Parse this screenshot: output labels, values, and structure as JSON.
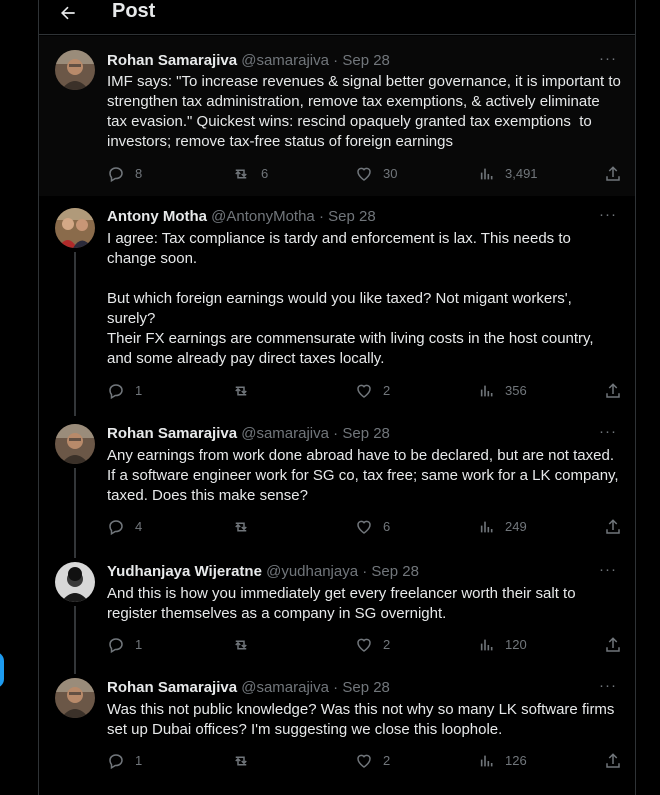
{
  "header": {
    "title": "Post"
  },
  "tweets": [
    {
      "name": "Rohan Samarajiva",
      "handle": "@samarajiva",
      "date": "Sep 28",
      "text": "IMF says: \"To increase revenues & signal better governance, it is important to strengthen tax administration, remove tax exemptions, & actively eliminate tax evasion.\" Quickest wins: rescind opaquely granted tax exemptions  to investors; remove tax-free status of foreign earnings",
      "replies": "8",
      "reposts": "6",
      "likes": "30",
      "views": "3,491"
    },
    {
      "name": "Antony Motha",
      "handle": "@AntonyMotha",
      "date": "Sep 28",
      "text": "I agree: Tax compliance is tardy and enforcement is lax. This needs to change soon.\n\nBut which foreign earnings would you like taxed? Not migant workers', surely?\nTheir FX earnings are commensurate with living costs in the host country, and some already pay direct taxes locally.",
      "replies": "1",
      "reposts": "",
      "likes": "2",
      "views": "356"
    },
    {
      "name": "Rohan Samarajiva",
      "handle": "@samarajiva",
      "date": "Sep 28",
      "text": "Any earnings from work done abroad have to be declared, but are not taxed. If a software engineer work for SG co, tax free; same work for a LK company, taxed. Does this make sense?",
      "replies": "4",
      "reposts": "",
      "likes": "6",
      "views": "249"
    },
    {
      "name": "Yudhanjaya Wijeratne",
      "handle": "@yudhanjaya",
      "date": "Sep 28",
      "text": "And this is how you immediately get every freelancer worth their salt to register themselves as a company in SG overnight.",
      "replies": "1",
      "reposts": "",
      "likes": "2",
      "views": "120"
    },
    {
      "name": "Rohan Samarajiva",
      "handle": "@samarajiva",
      "date": "Sep 28",
      "text": "Was this not public knowledge? Was this not why so many LK software firms set up Dubai offices? I'm suggesting we close this loophole.",
      "replies": "1",
      "reposts": "",
      "likes": "2",
      "views": "126"
    }
  ],
  "colors": {
    "background": "#000000",
    "text": "#e7e9ea",
    "muted": "#71767b",
    "border": "#2f3336",
    "accent": "#1d9bf0"
  }
}
